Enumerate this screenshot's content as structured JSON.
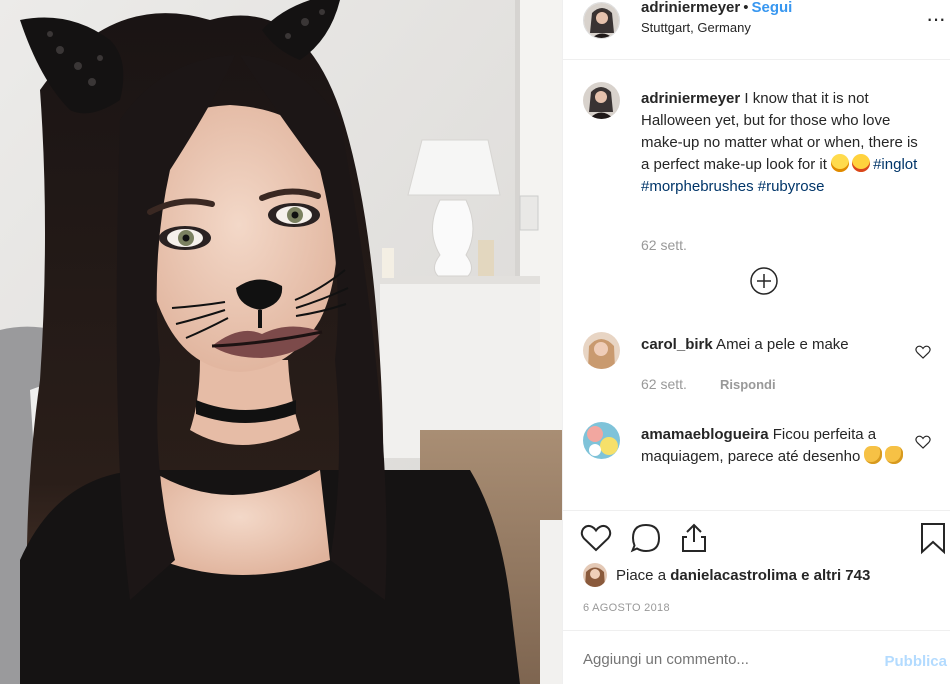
{
  "post": {
    "image_alt": "Selfie with cat make-up and lace cat ears",
    "author": {
      "username": "adriniermeyer",
      "separator": "•",
      "follow_label": "Segui",
      "location": "Stuttgart, Germany"
    },
    "more_icon": "more-options-icon",
    "caption": {
      "username": "adriniermeyer",
      "text": " I know that it is not Halloween yet, but for those who love make-up no matter what or when, there is a perfect make-up look for it ",
      "emojis": [
        "smiling-face-emoji",
        "star-struck-emoji"
      ],
      "hashtags": [
        "#inglot",
        "#morphebrushes",
        "#rubyrose"
      ],
      "time": "62 sett."
    },
    "load_more_icon": "plus-circle-icon",
    "comments": [
      {
        "username": "carol_birk",
        "text": " Amei a pele e make",
        "time": "62 sett.",
        "reply_label": "Rispondi"
      },
      {
        "username": "amamaeblogueira",
        "text": " Ficou perfeita a maquiagem, parece até desenho ",
        "emojis": [
          "clapping-hands-emoji",
          "clapping-hands-emoji"
        ]
      }
    ],
    "likes": {
      "prefix": "Piace a ",
      "liker": "danielacastrolima",
      "suffix": " e altri 743"
    },
    "date": "6 AGOSTO 2018",
    "add_comment": {
      "placeholder": "Aggiungi un commento...",
      "publish_label": "Pubblica"
    },
    "colors": {
      "link_blue": "#3897f0",
      "hashtag": "#003569",
      "muted": "#999999",
      "publish_disabled": "#b3dbff"
    }
  }
}
